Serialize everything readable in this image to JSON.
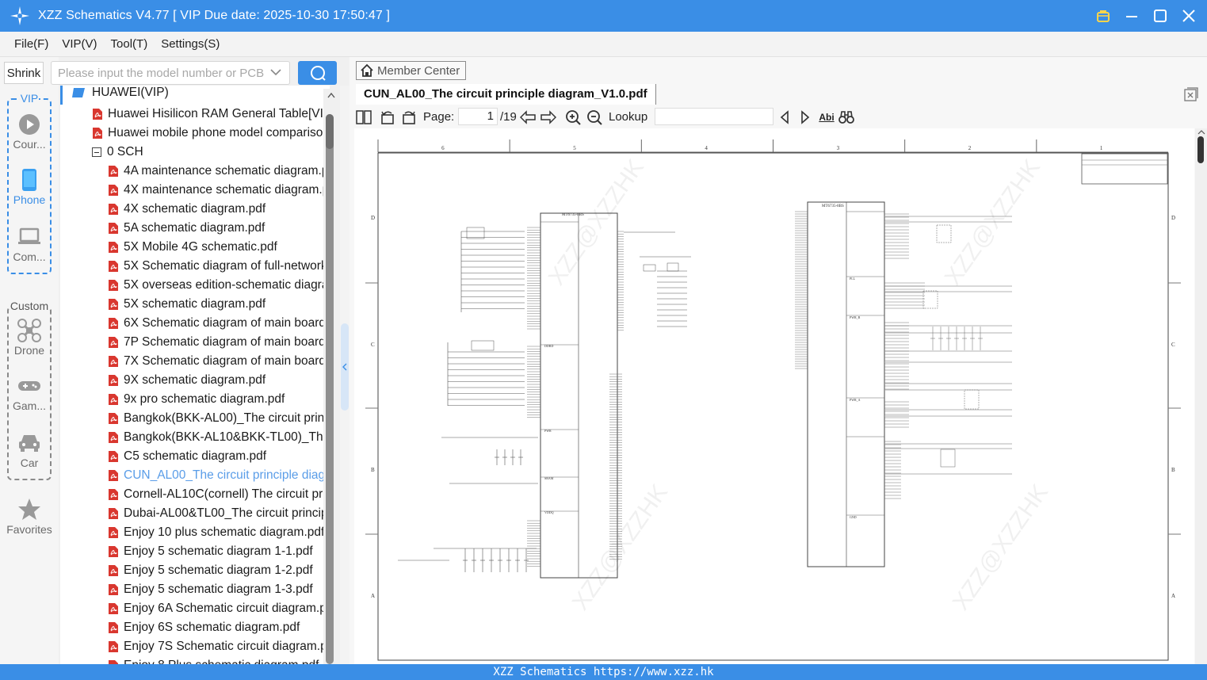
{
  "window": {
    "title": "XZZ Schematics V4.77 [ VIP Due date: 2025-10-30 17:50:47 ]"
  },
  "menu": [
    "File(F)",
    "VIP(V)",
    "Tool(T)",
    "Settings(S)"
  ],
  "sidebar": {
    "shrink_label": "Shrink",
    "vip_group_label": "VIP",
    "custom_group_label": "Custom",
    "items": [
      {
        "label": "Cour...",
        "icon": "play-icon"
      },
      {
        "label": "Phone",
        "icon": "phone-icon"
      },
      {
        "label": "Com...",
        "icon": "laptop-icon"
      },
      {
        "label": "Drone",
        "icon": "drone-icon"
      },
      {
        "label": "Gam...",
        "icon": "gamepad-icon"
      },
      {
        "label": "Car",
        "icon": "car-icon"
      },
      {
        "label": "Favorites",
        "icon": "star-icon"
      }
    ]
  },
  "search": {
    "placeholder": "Please input the model number or PCB"
  },
  "tree": {
    "root": "HUAWEI(VIP)",
    "top_files": [
      "Huawei Hisilicon RAM General Table[VIP",
      "Huawei mobile phone model compariso"
    ],
    "folder": "0 SCH",
    "files": [
      "4A maintenance schematic diagram.p",
      "4X maintenance schematic diagram.p",
      "4X schematic diagram.pdf",
      "5A schematic diagram.pdf",
      "5X Mobile 4G schematic.pdf",
      "5X Schematic diagram of full-network",
      "5X overseas edition-schematic diagra",
      "5X schematic diagram.pdf",
      "6X Schematic diagram of main board",
      "7P Schematic diagram of main board",
      "7X Schematic diagram of main board",
      "9X schematic diagram.pdf",
      "9x pro schematic diagram.pdf",
      "Bangkok(BKK-AL00)_The circuit princ",
      "Bangkok(BKK-AL10&BKK-TL00)_The c",
      "C5 schematic diagram.pdf",
      "CUN_AL00_The circuit principle diagra",
      "Cornell-AL10C(cornell) The circuit pri",
      "Dubai-AL00&TL00_The circuit princip",
      "Enjoy 10 plus schematic diagram.pdf",
      "Enjoy 5 schematic diagram 1-1.pdf",
      "Enjoy 5 schematic diagram 1-2.pdf",
      "Enjoy 5 schematic diagram 1-3.pdf",
      "Enjoy 6A Schematic circuit diagram.p",
      "Enjoy 6S schematic diagram.pdf",
      "Enjoy 7S Schematic circuit diagram.pc",
      "Enjoy 8 Plus schematic diagram.pdf"
    ],
    "selected_index": 16
  },
  "viewer": {
    "member_center": "Member Center",
    "doc_title": "CUN_AL00_The circuit principle diagram_V1.0.pdf",
    "page_label": "Page:",
    "page_current": "1",
    "page_total": "/19",
    "lookup_label": "Lookup",
    "abi_label": "Abi",
    "schematic": {
      "columns": [
        "6",
        "5",
        "4",
        "3",
        "2",
        "1"
      ],
      "rows": [
        "D",
        "C",
        "B",
        "A"
      ],
      "chip_left": "MT6735-8BS",
      "chip_right": "MT6735-8BS",
      "left_blocks": [
        "DDRD",
        "PWR",
        "SRAM",
        "VDDQ"
      ],
      "right_blocks": [
        "PLL",
        "PWR_B",
        "PWR_A",
        "GND"
      ],
      "watermark": "XZZ@XZZHK"
    }
  },
  "footer": {
    "text": "XZZ Schematics https://www.xzz.hk"
  },
  "colors": {
    "accent": "#3a8ee6",
    "pdf_red": "#d9372f",
    "selected_text": "#5a9de8"
  }
}
